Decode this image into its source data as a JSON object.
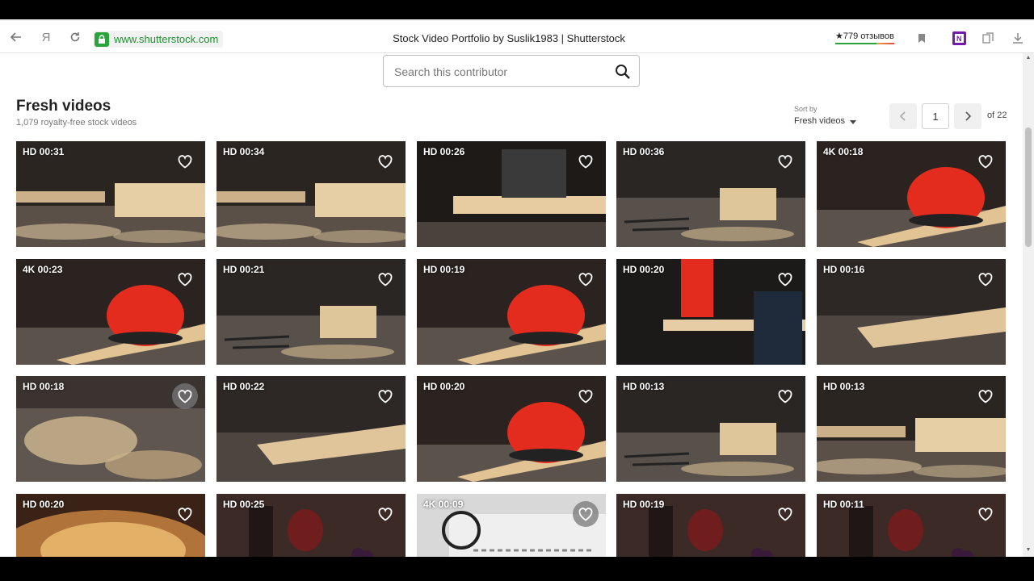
{
  "browser": {
    "url": "www.shutterstock.com",
    "tab_title": "Stock Video Portfolio by Suslik1983 | Shutterstock",
    "reviews": "★779 отзывов",
    "yandex_label": "Я"
  },
  "search": {
    "placeholder": "Search this contributor"
  },
  "header": {
    "title": "Fresh videos",
    "subtitle": "1,079 royalty-free stock videos"
  },
  "sort": {
    "label": "Sort by",
    "value": "Fresh videos"
  },
  "pagination": {
    "current": "1",
    "total": "of 22"
  },
  "videos": [
    {
      "badge": "HD  00:31"
    },
    {
      "badge": "HD  00:34"
    },
    {
      "badge": "HD  00:26"
    },
    {
      "badge": "HD  00:36"
    },
    {
      "badge": "4K  00:18"
    },
    {
      "badge": "4K  00:23"
    },
    {
      "badge": "HD  00:21"
    },
    {
      "badge": "HD  00:19"
    },
    {
      "badge": "HD  00:20"
    },
    {
      "badge": "HD  00:16"
    },
    {
      "badge": "HD  00:18"
    },
    {
      "badge": "HD  00:22"
    },
    {
      "badge": "HD  00:20"
    },
    {
      "badge": "HD  00:13"
    },
    {
      "badge": "HD  00:13"
    },
    {
      "badge": "HD  00:20"
    },
    {
      "badge": "HD  00:25"
    },
    {
      "badge": "4K  00:09"
    },
    {
      "badge": "HD  00:19"
    },
    {
      "badge": "HD  00:11"
    }
  ],
  "colors": {
    "accent_green": "#2aa33b",
    "sander_red": "#e32b1e"
  }
}
